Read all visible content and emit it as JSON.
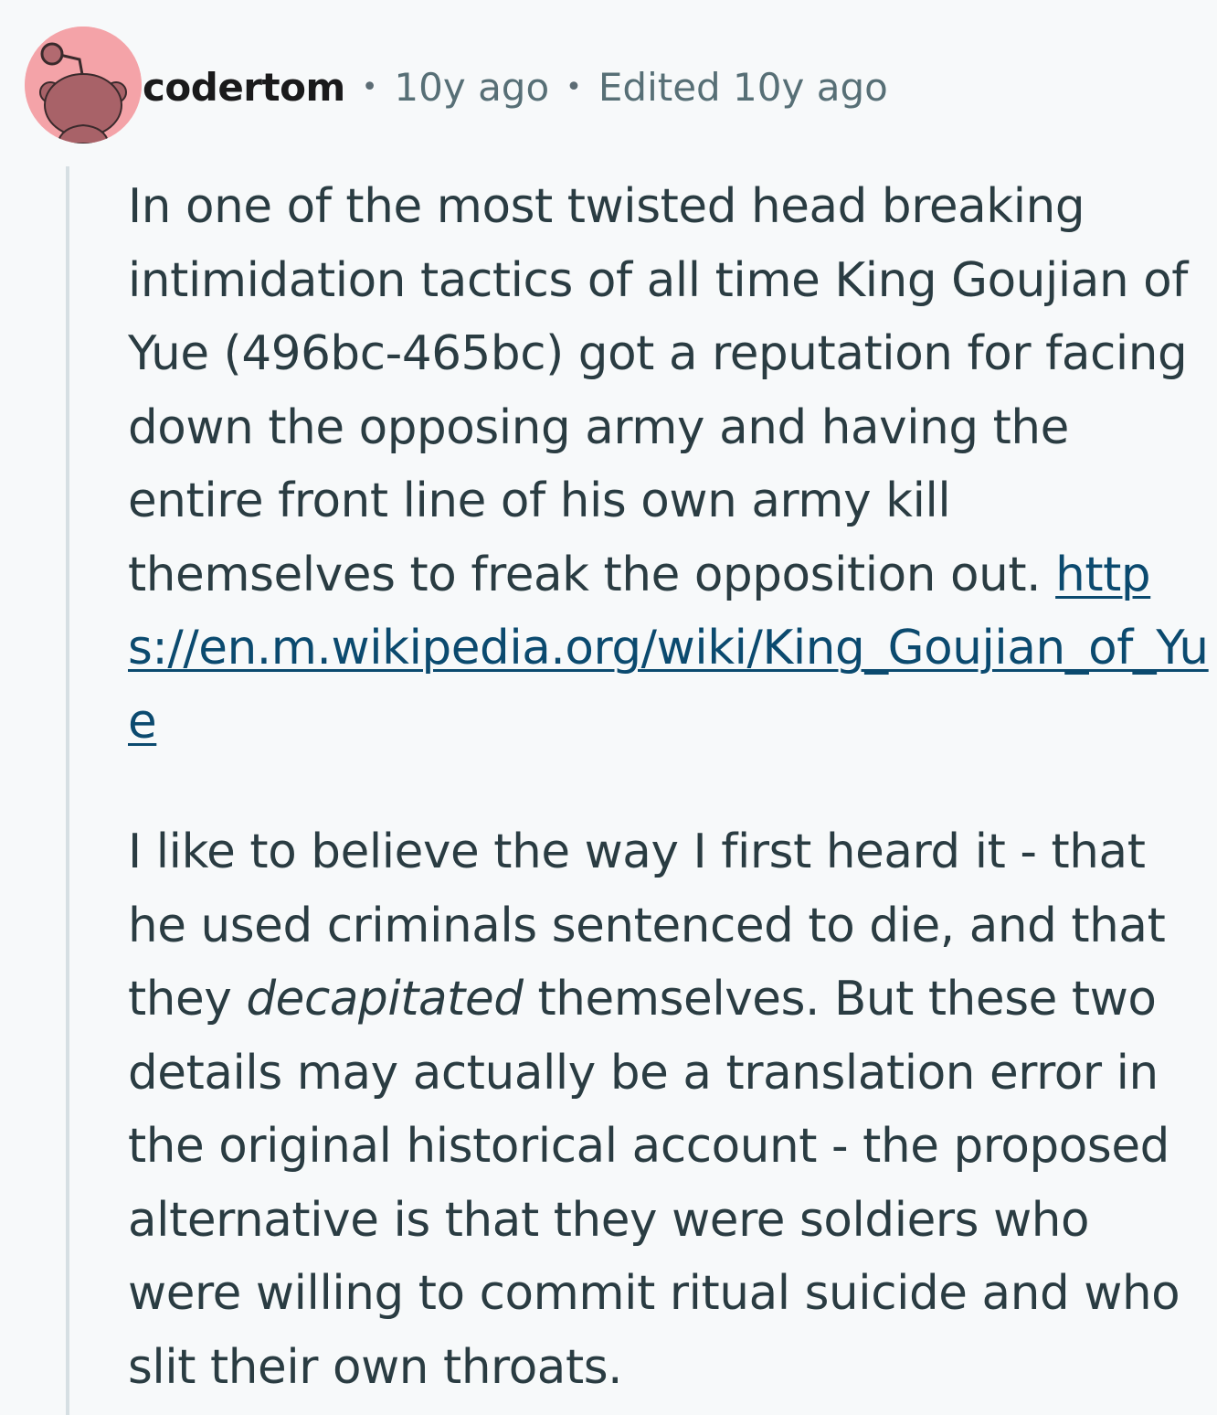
{
  "comment": {
    "author": "codertom",
    "separator": "•",
    "time_ago": "10y ago",
    "edited": "Edited 10y ago",
    "avatar_icon": "reddit-snoo-avatar-icon",
    "avatar_bg": "#f4a3a8",
    "paragraph1_text": "In one of the most twisted head breaking intimidation tactics of all time King Goujian of Yue (496bc-465bc) got a reputation for facing down the opposing army and having the entire front line of his own army kill themselves to freak the opposition out.",
    "link_text": "https://en.m.wikipedia.org/wiki/King_Goujian_of_Yue",
    "paragraph2_before": "I like to believe the way I first heard it - that he used criminals sentenced to die, and that they ",
    "paragraph2_emphasis": "decapitated",
    "paragraph2_after": " themselves. But these two details may actually be a translation error in the original historical account - the proposed alternative is that they were soldiers who were willing to commit ritual suicide and who slit their own throats.",
    "link_color": "#0b4a6f",
    "text_color": "#2a3c42"
  }
}
